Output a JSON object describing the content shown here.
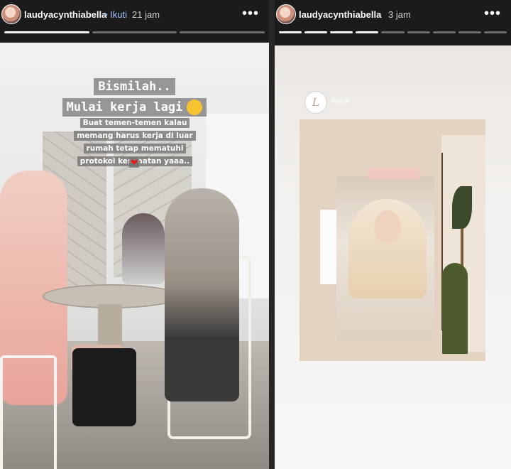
{
  "stories": [
    {
      "username": "laudyacynthiabella",
      "follow_label": "• Ikuti",
      "time": "21 jam",
      "more_label": "•••",
      "progress": {
        "segments": 3,
        "completed": 1
      },
      "sticker_title_line1": "Bismilah..",
      "sticker_title_line2": "Mulai kerja lagi",
      "caption": "Buat temen-temen kalau memang harus kerja di luar rumah tetap mematuhi protokol kesehatan yaaa..",
      "heart_symbol": "❤"
    },
    {
      "username": "laudyacynthiabella",
      "time": "3 jam",
      "more_label": "•••",
      "progress": {
        "segments": 9,
        "completed": 4
      },
      "watermark_logo": "L",
      "watermark_handle": "lbylcb"
    }
  ],
  "colors": {
    "background": "#262626",
    "follow": "#9fc4ff",
    "progress_active": "#ffffff"
  }
}
